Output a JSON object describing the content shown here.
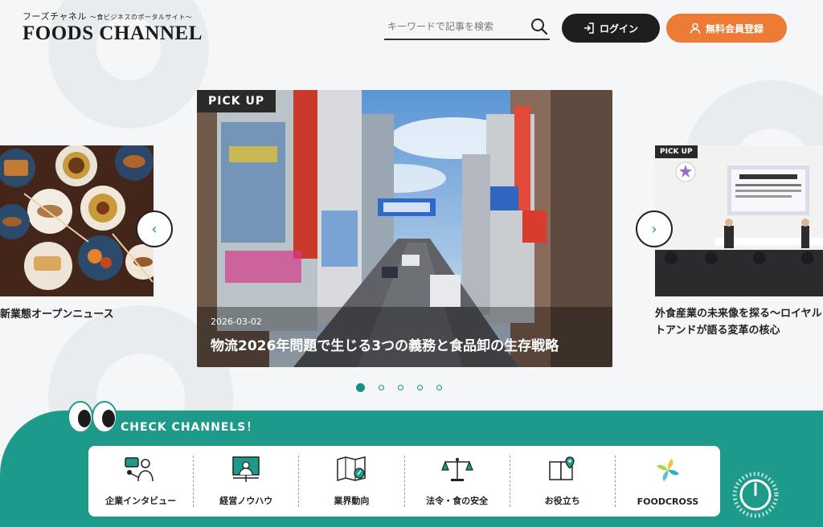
{
  "header": {
    "logo_top": "フーズチャネル",
    "logo_tagline": "〜食ビジネスのポータルサイト〜",
    "logo_main": "FOODS CHANNEL",
    "search_placeholder": "キーワードで記事を検索",
    "login_label": "ログイン",
    "register_label": "無料会員登録"
  },
  "carousel": {
    "main": {
      "badge": "PICK UP",
      "date": "2026-03-02",
      "title": "物流2026年問題で生じる3つの義務と食品卸の生存戦略"
    },
    "left": {
      "caption": "新業態オープンニュース"
    },
    "right": {
      "badge": "PICK UP",
      "caption_line1": "外食産業の未来像を探る〜ロイヤル",
      "caption_line2": "トアンドが語る変革の核心"
    },
    "slide_count": 5,
    "active_slide": 1
  },
  "channels": {
    "title": "CHECK CHANNELS！",
    "items": [
      {
        "label": "企業インタビュー",
        "icon": "interview-icon"
      },
      {
        "label": "経営ノウハウ",
        "icon": "presentation-icon"
      },
      {
        "label": "業界動向",
        "icon": "map-compass-icon"
      },
      {
        "label": "法令・食の安全",
        "icon": "scales-icon"
      },
      {
        "label": "お役立ち",
        "icon": "book-location-icon"
      },
      {
        "label": "FOODCROSS",
        "icon": "foodcross-logo-icon"
      }
    ]
  },
  "colors": {
    "accent": "#1e9a8a",
    "orange": "#ed7a35",
    "dark": "#1e1e1e"
  }
}
